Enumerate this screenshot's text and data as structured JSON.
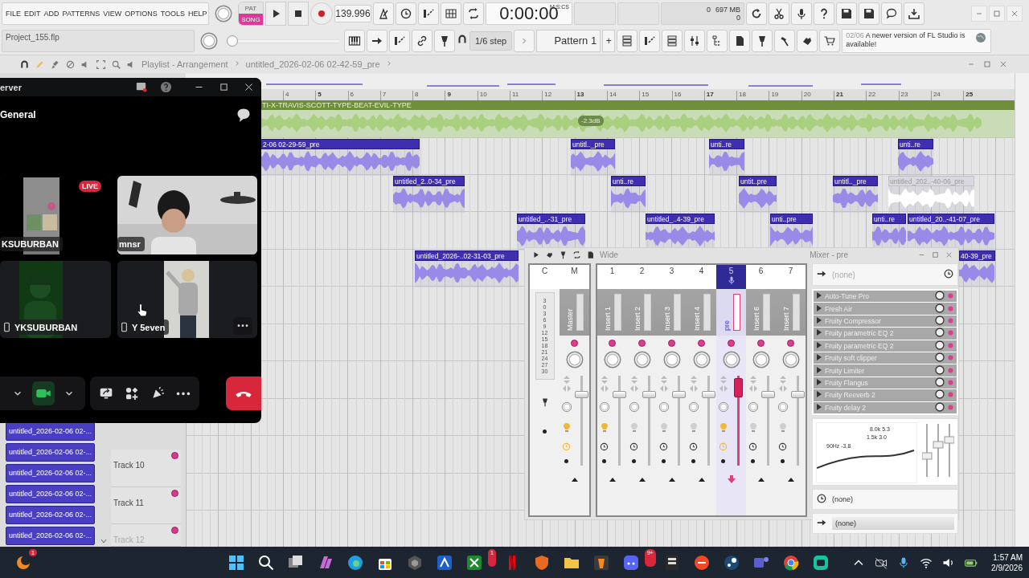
{
  "toolbar": {
    "menu": [
      "FILE",
      "EDIT",
      "ADD",
      "PATTERNS",
      "VIEW",
      "OPTIONS",
      "TOOLS",
      "HELP"
    ],
    "mode": [
      {
        "label": "PAT",
        "selected": false
      },
      {
        "label": "SONG",
        "selected": true
      }
    ],
    "tempo": "139.996",
    "time": "0:00:00",
    "time_unit": "M:S:CS",
    "cpu": "0",
    "memory": "697 MB",
    "polyphony": "0",
    "project": "Project_155.flp",
    "position": {
      "level": 0
    },
    "snap": "1/6 step",
    "pattern": "Pattern 1",
    "pattern_add": "+",
    "news": {
      "date": "02/06",
      "text": "A newer version of FL Studio is available!"
    }
  },
  "playlist": {
    "title": "Playlist - Arrangement",
    "breadcrumb": "untitled_2026-02-06 02-42-59_pre",
    "ruler": [
      "4",
      "5",
      "6",
      "7",
      "8",
      "9",
      "10",
      "11",
      "12",
      "13",
      "14",
      "15",
      "16",
      "17",
      "18",
      "19",
      "20",
      "21",
      "22",
      "23",
      "24",
      "25"
    ],
    "audio_track": {
      "name": "TI-X-TRAVIS-SCOTT-TYPE-BEAT-EVIL-TYPE",
      "gain": "-2.3dB"
    },
    "clips": [
      {
        "label": "2-06 02-29-59_pre",
        "muted": false
      },
      {
        "label": "untitl.._pre",
        "muted": false
      },
      {
        "label": "unti..re",
        "muted": false
      },
      {
        "label": "unti..re",
        "muted": false
      },
      {
        "label": "untitled_2..0-34_pre",
        "muted": false
      },
      {
        "label": "unti..re",
        "muted": false
      },
      {
        "label": "untit..pre",
        "muted": false
      },
      {
        "label": "untitl.._pre",
        "muted": false
      },
      {
        "label": "untitled_202..-40-06_pre",
        "muted": true
      },
      {
        "label": "untitled_..-31_pre",
        "muted": false
      },
      {
        "label": "untitled_..4-39_pre",
        "muted": false
      },
      {
        "label": "unti..pre",
        "muted": false
      },
      {
        "label": "unti..re",
        "muted": false
      },
      {
        "label": "untitled_20..-41-07_pre",
        "muted": false
      },
      {
        "label": "untitled_2026-..02-31-03_pre",
        "muted": false
      },
      {
        "label": "40-39_pre",
        "muted": false
      }
    ],
    "clip_list": [
      "untitled_2026-02-06 02-...",
      "untitled_2026-02-06 02-...",
      "untitled_2026-02-06 02-...",
      "untitled_2026-02-06 02-...",
      "untitled_2026-02-06 02-...",
      "untitled_2026-02-06 02-..."
    ],
    "tracks": [
      "Track 10",
      "Track 11",
      "Track 12"
    ]
  },
  "call": {
    "server": "erver",
    "channel": "General",
    "live_label": "LIVE",
    "camera_on": true,
    "participants": [
      {
        "name": "KSUBURBAN",
        "kind": "stream",
        "live": true,
        "mobile": false
      },
      {
        "name": "mnsr",
        "kind": "room",
        "live": false,
        "mobile": false
      },
      {
        "name": "YKSUBURBAN",
        "kind": "dark",
        "live": false,
        "mobile": true
      },
      {
        "name": "Y 5even",
        "kind": "standing",
        "live": false,
        "mobile": true
      }
    ]
  },
  "mixer": {
    "title": "Mixer - pre",
    "preset": "Wide",
    "current": "C",
    "meter_scale": [
      "3",
      "0",
      "3",
      "6",
      "9",
      "12",
      "15",
      "18",
      "21",
      "24",
      "27",
      "30"
    ],
    "strips": [
      {
        "number": "M",
        "name": "Master",
        "selected": false,
        "level": 0.82
      },
      {
        "number": "1",
        "name": "Insert 1",
        "selected": false,
        "level": 0.82
      },
      {
        "number": "2",
        "name": "Insert 2",
        "selected": false,
        "level": 0.82
      },
      {
        "number": "3",
        "name": "Insert 3",
        "selected": false,
        "level": 0.82
      },
      {
        "number": "4",
        "name": "Insert 4",
        "selected": false,
        "level": 0.82
      },
      {
        "number": "5",
        "name": "pre",
        "selected": true,
        "level": 0.97
      },
      {
        "number": "6",
        "name": "Insert 6",
        "selected": false,
        "level": 0.82
      },
      {
        "number": "7",
        "name": "Insert 7",
        "selected": false,
        "level": 0.82
      }
    ],
    "input": "(none)",
    "effects": [
      "Auto-Tune Pro",
      "Fresh Air",
      "Fruity Compressor",
      "Fruity parametric EQ 2",
      "Fruity parametric EQ 2",
      "Fruity soft clipper",
      "Fruity Limiter",
      "Fruity Flangus",
      "Fruity Reeverb 2",
      "Fruity delay 2"
    ],
    "eq_labels": [
      "8.0k 5.3",
      "1.5k 3.0",
      "90Hz -3.8"
    ],
    "outputs": [
      "(none)",
      "(none)"
    ]
  },
  "taskbar": {
    "weather_badge": "1",
    "xbox_badge": "1",
    "discord_badge": "9+",
    "time": "1:57 AM",
    "date": "2/9/2026"
  }
}
